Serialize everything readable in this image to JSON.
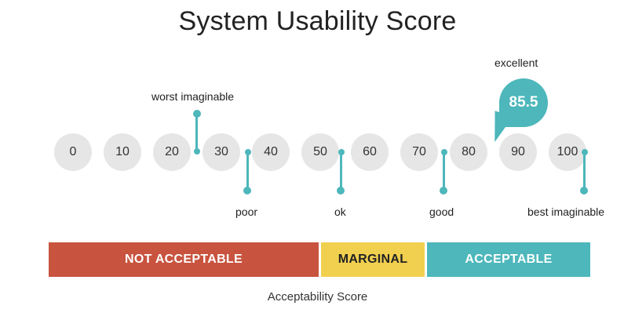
{
  "title": "System Usability Score",
  "scale_ticks": [
    "0",
    "10",
    "20",
    "30",
    "40",
    "50",
    "60",
    "70",
    "80",
    "90",
    "100"
  ],
  "markers": {
    "worst_imaginable": "worst imaginable",
    "poor": "poor",
    "ok": "ok",
    "good": "good",
    "excellent": "excellent",
    "best_imaginable": "best imaginable"
  },
  "score": "85.5",
  "bands": {
    "not_acceptable": "NOT ACCEPTABLE",
    "marginal": "MARGINAL",
    "acceptable": "ACCEPTABLE"
  },
  "subtitle": "Acceptability Score",
  "colors": {
    "teal": "#4db7bb",
    "not_acceptable": "#c8533f",
    "marginal": "#f1d04f",
    "acceptable": "#4db7bb",
    "tick_fill": "#e6e6e6"
  }
}
